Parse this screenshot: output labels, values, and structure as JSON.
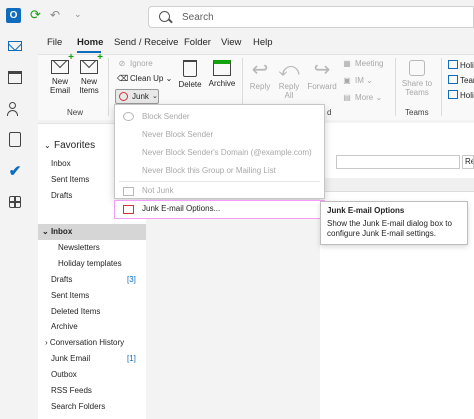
{
  "titlebar": {
    "app_icon_letter": "O",
    "search_placeholder": "Search"
  },
  "tabs": [
    "File",
    "Home",
    "Send / Receive",
    "Folder",
    "View",
    "Help"
  ],
  "ribbon": {
    "new_email": [
      "New",
      "Email"
    ],
    "new_items": [
      "New",
      "Items"
    ],
    "new_group_label": "New",
    "ignore": "Ignore",
    "clean_up": "Clean Up",
    "junk": "Junk",
    "delete": "Delete",
    "archive": "Archive",
    "reply": "Reply",
    "reply_all": [
      "Reply",
      "All"
    ],
    "forward": "Forward",
    "meeting": "Meeting",
    "im": "IM",
    "more": "More",
    "share_to_teams": [
      "Share to",
      "Teams"
    ],
    "teams_group_label": "Teams",
    "right_cut_1": "Holid",
    "right_cut_2": "Tean",
    "right_cut_3": "Holid",
    "partial_label": "d"
  },
  "folders": {
    "favorites_label": "Favorites",
    "favorites": [
      "Inbox",
      "Sent Items",
      "Drafts"
    ],
    "inbox_label": "Inbox",
    "inbox_children": [
      "Newsletters",
      "Holiday templates"
    ],
    "items": [
      {
        "name": "Drafts",
        "count": "[3]"
      },
      {
        "name": "Sent Items",
        "count": ""
      },
      {
        "name": "Deleted Items",
        "count": ""
      },
      {
        "name": "Archive",
        "count": ""
      },
      {
        "name": "Conversation History",
        "count": ""
      },
      {
        "name": "Junk Email",
        "count": "[1]"
      },
      {
        "name": "Outbox",
        "count": ""
      },
      {
        "name": "RSS Feeds",
        "count": ""
      },
      {
        "name": "Search Folders",
        "count": ""
      }
    ]
  },
  "junk_menu": {
    "block_sender": "Block Sender",
    "never_block_sender": "Never Block Sender",
    "never_block_domain": "Never Block Sender's Domain (@example.com)",
    "never_block_group": "Never Block this Group or Mailing List",
    "not_junk": "Not Junk",
    "junk_options": "Junk E-mail Options..."
  },
  "tooltip": {
    "title": "Junk E-mail Options",
    "body": "Show the Junk E-mail dialog box to configure Junk E-mail settings."
  },
  "right_pane": {
    "col_fragment": "Re"
  },
  "colors": {
    "accent": "#0f6cbd",
    "highlight_border": "#f39cf8",
    "junk_red": "#d13438",
    "green": "#13a10e"
  }
}
